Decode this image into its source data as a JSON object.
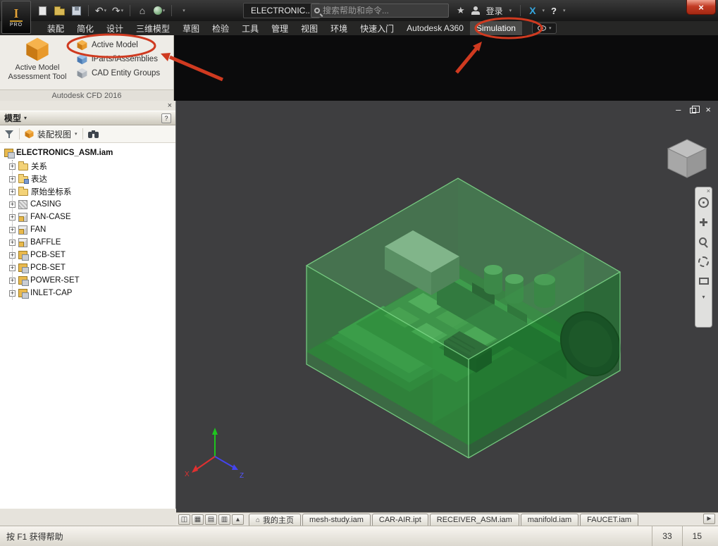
{
  "titlebar": {
    "app_badge": "PRO",
    "app_initial": "I",
    "doc_title": "ELECTRONIC...",
    "search_placeholder": "搜索帮助和命令...",
    "sign_in": "登录",
    "exchange": "X",
    "help": "?",
    "close": "×"
  },
  "ribbon": {
    "tabs": [
      "装配",
      "简化",
      "设计",
      "三维模型",
      "草图",
      "检验",
      "工具",
      "管理",
      "视图",
      "环境",
      "快速入门",
      "Autodesk A360",
      "Simulation"
    ],
    "active_tab": "Simulation",
    "big_button_line1": "Active Model",
    "big_button_line2": "Assessment Tool",
    "items": [
      "Active Model",
      "iParts/iAssemblies",
      "CAD Entity Groups"
    ],
    "panel_title": "Autodesk CFD 2016"
  },
  "browser": {
    "panel_title": "模型",
    "view_selector": "装配视图",
    "root_label": "ELECTRONICS_ASM.iam",
    "items": [
      "关系",
      "表达",
      "原始坐标系",
      "CASING",
      "FAN-CASE",
      "FAN",
      "BAFFLE",
      "PCB-SET",
      "PCB-SET",
      "POWER-SET",
      "INLET-CAP"
    ]
  },
  "viewport": {
    "axis_x": "X",
    "axis_z": "Z"
  },
  "doc_tabs": [
    "我的主页",
    "mesh-study.iam",
    "CAR-AIR.ipt",
    "RECEIVER_ASM.iam",
    "manifold.iam",
    "FAUCET.iam"
  ],
  "statusbar": {
    "hint": "按 F1 获得帮助",
    "count_a": "33",
    "count_b": "15"
  },
  "colors": {
    "annotation_red": "#cf3a20",
    "model_green": "#2e8b3a",
    "viewport_bg": "#3e3e40"
  }
}
